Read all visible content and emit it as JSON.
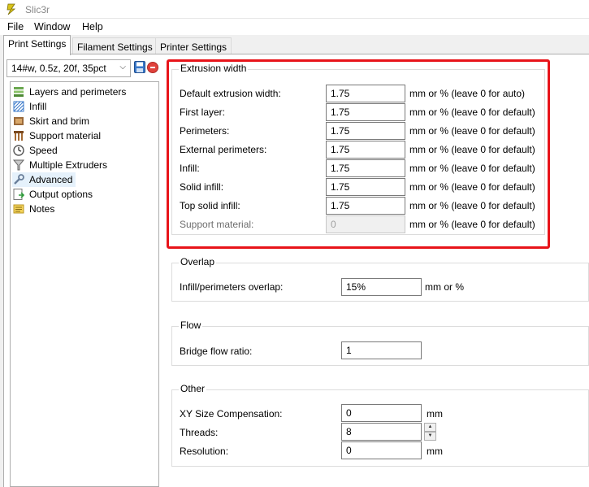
{
  "window": {
    "title": "Slic3r"
  },
  "menu": [
    "File",
    "Window",
    "Help"
  ],
  "tabs": [
    {
      "label": "Print Settings",
      "active": true
    },
    {
      "label": "Filament Settings",
      "active": false
    },
    {
      "label": "Printer Settings",
      "active": false
    }
  ],
  "preset": {
    "value": "14#w, 0.5z, 20f, 35pct"
  },
  "tree": [
    {
      "label": "Layers and perimeters",
      "icon": "layers-icon"
    },
    {
      "label": "Infill",
      "icon": "infill-icon"
    },
    {
      "label": "Skirt and brim",
      "icon": "skirt-brim-icon"
    },
    {
      "label": "Support material",
      "icon": "support-material-icon"
    },
    {
      "label": "Speed",
      "icon": "speed-icon"
    },
    {
      "label": "Multiple Extruders",
      "icon": "funnel-icon"
    },
    {
      "label": "Advanced",
      "icon": "wrench-icon",
      "selected": true
    },
    {
      "label": "Output options",
      "icon": "output-icon"
    },
    {
      "label": "Notes",
      "icon": "notes-icon"
    }
  ],
  "extrusion_width": {
    "title": "Extrusion width",
    "rows": [
      {
        "label": "Default extrusion width:",
        "value": "1.75",
        "unit": "mm or % (leave 0 for auto)",
        "disabled": false
      },
      {
        "label": "First layer:",
        "value": "1.75",
        "unit": "mm or % (leave 0 for default)",
        "disabled": false
      },
      {
        "label": "Perimeters:",
        "value": "1.75",
        "unit": "mm or % (leave 0 for default)",
        "disabled": false
      },
      {
        "label": "External perimeters:",
        "value": "1.75",
        "unit": "mm or % (leave 0 for default)",
        "disabled": false
      },
      {
        "label": "Infill:",
        "value": "1.75",
        "unit": "mm or % (leave 0 for default)",
        "disabled": false
      },
      {
        "label": "Solid infill:",
        "value": "1.75",
        "unit": "mm or % (leave 0 for default)",
        "disabled": false
      },
      {
        "label": "Top solid infill:",
        "value": "1.75",
        "unit": "mm or % (leave 0 for default)",
        "disabled": false
      },
      {
        "label": "Support material:",
        "value": "0",
        "unit": "mm or % (leave 0 for default)",
        "disabled": true
      }
    ]
  },
  "overlap": {
    "title": "Overlap",
    "label": "Infill/perimeters overlap:",
    "value": "15%",
    "unit": "mm or %"
  },
  "flow": {
    "title": "Flow",
    "label": "Bridge flow ratio:",
    "value": "1"
  },
  "other": {
    "title": "Other",
    "xy_label": "XY Size Compensation:",
    "xy_value": "0",
    "xy_unit": "mm",
    "threads_label": "Threads:",
    "threads_value": "8",
    "resolution_label": "Resolution:",
    "resolution_value": "0",
    "resolution_unit": "mm"
  },
  "colors": {
    "highlight": "#e8141a",
    "selected_bg": "#e5f1fb"
  }
}
